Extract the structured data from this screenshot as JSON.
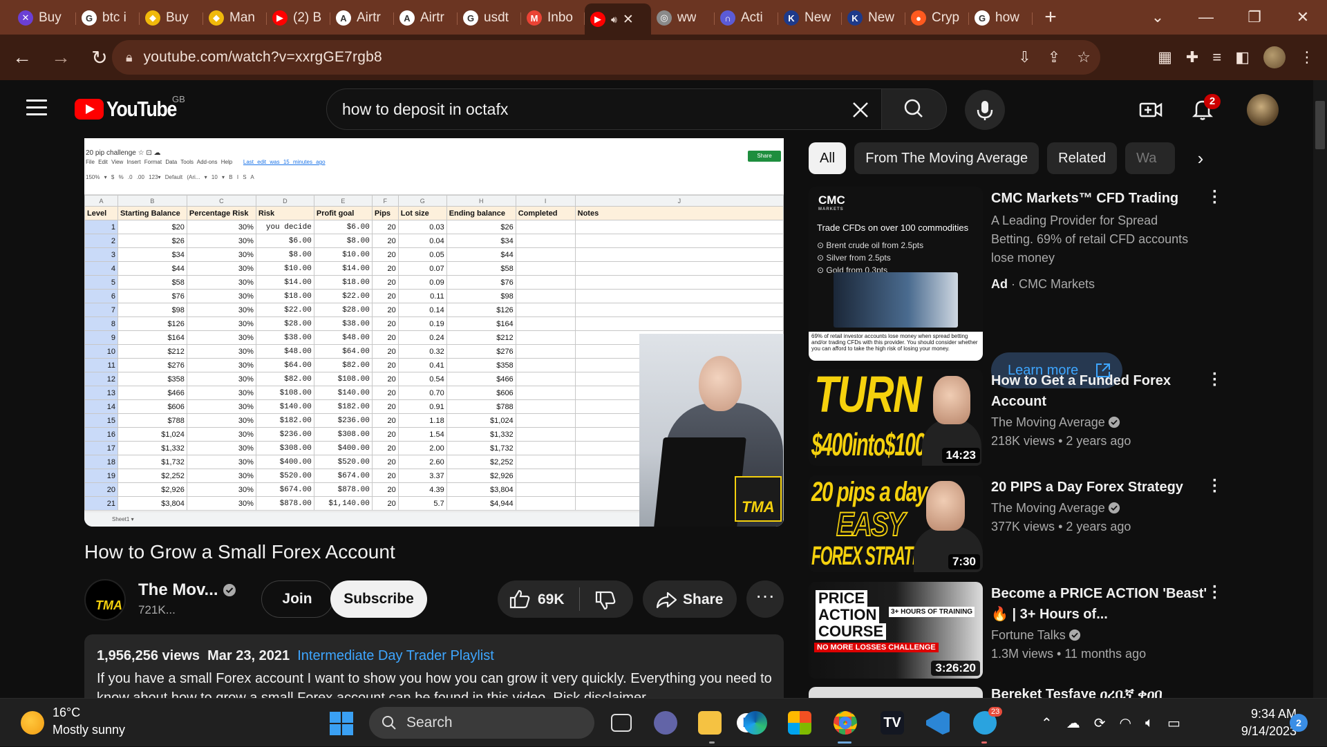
{
  "browser": {
    "tabs": [
      {
        "label": "Buy",
        "fav_color": "#6b3fd4",
        "fav_glyph": "✕"
      },
      {
        "label": "btc i",
        "fav_color": "#ffffff",
        "fav_glyph": "G"
      },
      {
        "label": "Buy",
        "fav_color": "#f0b90b",
        "fav_glyph": "◆"
      },
      {
        "label": "Man",
        "fav_color": "#f0b90b",
        "fav_glyph": "◆"
      },
      {
        "label": "(2) B",
        "fav_color": "#ff0000",
        "fav_glyph": "▶"
      },
      {
        "label": "Airtr",
        "fav_color": "#ffffff",
        "fav_glyph": "A"
      },
      {
        "label": "Airtr",
        "fav_color": "#ffffff",
        "fav_glyph": "A"
      },
      {
        "label": "usdt",
        "fav_color": "#ffffff",
        "fav_glyph": "G"
      },
      {
        "label": "Inbo",
        "fav_color": "#ea4335",
        "fav_glyph": "M"
      },
      {
        "label": "",
        "fav_color": "#ff0000",
        "fav_glyph": "▶",
        "active": true
      },
      {
        "label": "ww",
        "fav_color": "#8a8a8a",
        "fav_glyph": "◎"
      },
      {
        "label": "Acti",
        "fav_color": "#5b5bd6",
        "fav_glyph": "∩"
      },
      {
        "label": "New",
        "fav_color": "#1e3a8a",
        "fav_glyph": "K"
      },
      {
        "label": "New",
        "fav_color": "#1e3a8a",
        "fav_glyph": "K"
      },
      {
        "label": "Cryp",
        "fav_color": "#ff5a1f",
        "fav_glyph": "●"
      },
      {
        "label": "how",
        "fav_color": "#ffffff",
        "fav_glyph": "G"
      }
    ],
    "url": "youtube.com/watch?v=xxrgGE7rgb8"
  },
  "youtube": {
    "logo_text": "YouTube",
    "country": "GB",
    "search_value": "how to deposit in octafx",
    "notifications": "2"
  },
  "sheet": {
    "title": "20 pip challenge",
    "menu": "File Edit View Insert Format Data Tools Add-ons Help",
    "last_edit": "Last edit was 15 minutes ago",
    "toolbar": "150% ▾  $  %  .0  .00  123▾  Default (Ari... ▾  10 ▾  B  I  S  A",
    "share": "Share",
    "col_letters": [
      "A",
      "B",
      "C",
      "D",
      "E",
      "F",
      "G",
      "H",
      "I",
      "J"
    ],
    "headers": [
      "Level",
      "Starting Balance",
      "Percentage Risk",
      "Risk",
      "Profit goal",
      "Pips",
      "Lot size",
      "Ending balance",
      "Completed",
      "Notes"
    ],
    "rows": [
      [
        "1",
        "$20",
        "30%",
        "you decide",
        "$6.00",
        "20",
        "0.03",
        "$26"
      ],
      [
        "2",
        "$26",
        "30%",
        "$6.00",
        "$8.00",
        "20",
        "0.04",
        "$34"
      ],
      [
        "3",
        "$34",
        "30%",
        "$8.00",
        "$10.00",
        "20",
        "0.05",
        "$44"
      ],
      [
        "4",
        "$44",
        "30%",
        "$10.00",
        "$14.00",
        "20",
        "0.07",
        "$58"
      ],
      [
        "5",
        "$58",
        "30%",
        "$14.00",
        "$18.00",
        "20",
        "0.09",
        "$76"
      ],
      [
        "6",
        "$76",
        "30%",
        "$18.00",
        "$22.00",
        "20",
        "0.11",
        "$98"
      ],
      [
        "7",
        "$98",
        "30%",
        "$22.00",
        "$28.00",
        "20",
        "0.14",
        "$126"
      ],
      [
        "8",
        "$126",
        "30%",
        "$28.00",
        "$38.00",
        "20",
        "0.19",
        "$164"
      ],
      [
        "9",
        "$164",
        "30%",
        "$38.00",
        "$48.00",
        "20",
        "0.24",
        "$212"
      ],
      [
        "10",
        "$212",
        "30%",
        "$48.00",
        "$64.00",
        "20",
        "0.32",
        "$276"
      ],
      [
        "11",
        "$276",
        "30%",
        "$64.00",
        "$82.00",
        "20",
        "0.41",
        "$358"
      ],
      [
        "12",
        "$358",
        "30%",
        "$82.00",
        "$108.00",
        "20",
        "0.54",
        "$466"
      ],
      [
        "13",
        "$466",
        "30%",
        "$108.00",
        "$140.00",
        "20",
        "0.70",
        "$606"
      ],
      [
        "14",
        "$606",
        "30%",
        "$140.00",
        "$182.00",
        "20",
        "0.91",
        "$788"
      ],
      [
        "15",
        "$788",
        "30%",
        "$182.00",
        "$236.00",
        "20",
        "1.18",
        "$1,024"
      ],
      [
        "16",
        "$1,024",
        "30%",
        "$236.00",
        "$308.00",
        "20",
        "1.54",
        "$1,332"
      ],
      [
        "17",
        "$1,332",
        "30%",
        "$308.00",
        "$400.00",
        "20",
        "2.00",
        "$1,732"
      ],
      [
        "18",
        "$1,732",
        "30%",
        "$400.00",
        "$520.00",
        "20",
        "2.60",
        "$2,252"
      ],
      [
        "19",
        "$2,252",
        "30%",
        "$520.00",
        "$674.00",
        "20",
        "3.37",
        "$2,926"
      ],
      [
        "20",
        "$2,926",
        "30%",
        "$674.00",
        "$878.00",
        "20",
        "4.39",
        "$3,804"
      ],
      [
        "21",
        "$3,804",
        "30%",
        "$878.00",
        "$1,140.00",
        "20",
        "5.7",
        "$4,944"
      ]
    ],
    "sheet_tab": "Sheet1 ▾",
    "watermark": "TMA"
  },
  "video": {
    "title": "How to Grow a Small Forex Account",
    "channel_name": "The Mov...",
    "channel_subs": "721K...",
    "channel_avatar_text": "TMA",
    "join_label": "Join",
    "subscribe_label": "Subscribe",
    "like_count": "69K",
    "share_label": "Share",
    "views": "1,956,256 views",
    "date": "Mar 23, 2021",
    "playlist": "Intermediate Day Trader Playlist",
    "description": "If you have a small Forex account I want to show you how you can grow it very quickly. Everything you need to know about how to grow a small Forex account can be found in this video. Risk disclaimer"
  },
  "sidebar": {
    "chips": [
      "All",
      "From The Moving Average",
      "Related",
      "Wa"
    ],
    "ad": {
      "title": "CMC Markets™ CFD Trading",
      "description": "A Leading Provider for Spread Betting. 69% of retail CFD accounts lose money",
      "ad_label": "Ad",
      "advertiser": "CMC Markets",
      "learn_more": "Learn more",
      "thumb_logo": "CMC",
      "thumb_logo_sub": "MARKETS",
      "thumb_headline": "Trade CFDs on over 100 commodities",
      "thumb_items": [
        "⊙ Brent crude oil from 2.5pts",
        "⊙ Silver from 2.5pts",
        "⊙ Gold from 0.3pts"
      ],
      "thumb_disclaimer": "69% of retail investor accounts lose money when spread betting and/or trading CFDs with this provider. You should consider whether you can afford to take the high risk of losing your money."
    },
    "videos": [
      {
        "title": "How to Get a Funded Forex Account",
        "channel": "The Moving Average",
        "views": "218K views",
        "age": "2 years ago",
        "duration": "14:23",
        "thumb_line1": "TURN",
        "thumb_line2": "$400into$100,000"
      },
      {
        "title": "20 PIPS a Day Forex Strategy",
        "channel": "The Moving Average",
        "views": "377K views",
        "age": "2 years ago",
        "duration": "7:30",
        "thumb_line1": "20 pips a day",
        "thumb_line2": "EASY",
        "thumb_line3": "FOREX STRATEGY"
      },
      {
        "title": "Become a PRICE ACTION 'Beast' 🔥 | 3+ Hours of...",
        "channel": "Fortune Talks",
        "views": "1.3M views",
        "age": "11 months ago",
        "duration": "3:26:20",
        "thumb_words": [
          "PRICE",
          "ACTION",
          "COURSE"
        ],
        "thumb_red": "NO MORE LOSSES CHALLENGE",
        "thumb_hours": "3+ HOURS OF TRAINING"
      }
    ],
    "partial_title": "Bereket Tesfaye ዐረቢኛ ቀዐበ"
  },
  "taskbar": {
    "temp": "16°C",
    "weather": "Mostly sunny",
    "search": "Search",
    "time": "9:34 AM",
    "date": "9/14/2023",
    "telegram_badge": "23",
    "notif_count": "2"
  }
}
